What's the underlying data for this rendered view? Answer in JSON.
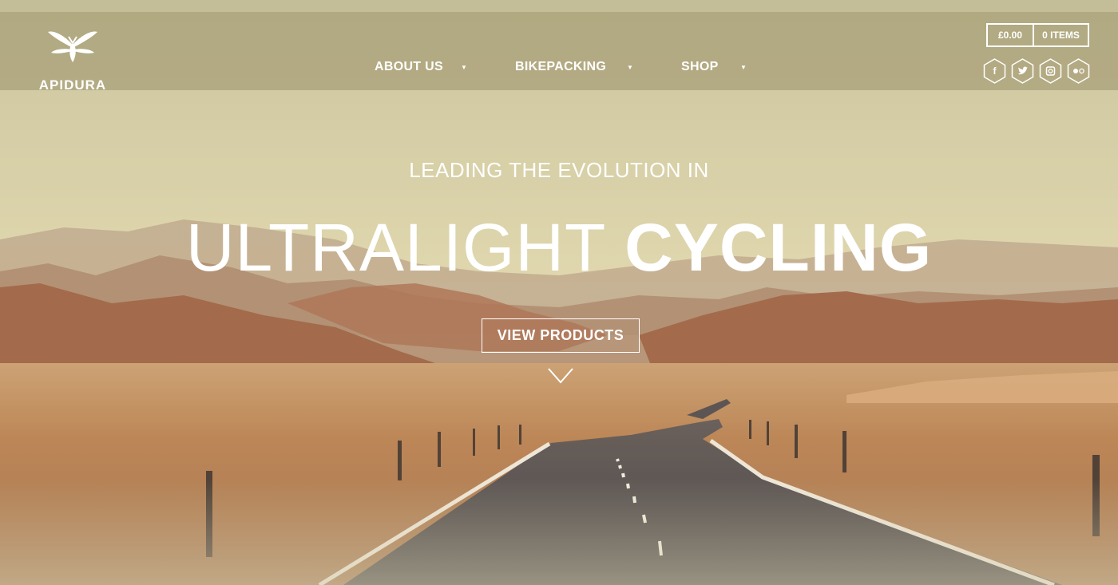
{
  "brand": {
    "name": "APIDURA"
  },
  "nav": {
    "items": [
      {
        "label": "ABOUT US"
      },
      {
        "label": "BIKEPACKING"
      },
      {
        "label": "SHOP"
      }
    ],
    "caret": "▼"
  },
  "cart": {
    "total": "£0.00",
    "items": "0 ITEMS"
  },
  "social": [
    {
      "name": "facebook-icon",
      "glyph": "f"
    },
    {
      "name": "twitter-icon",
      "glyph": "t"
    },
    {
      "name": "instagram-icon",
      "glyph": ""
    },
    {
      "name": "flickr-icon",
      "glyph": ""
    }
  ],
  "hero": {
    "kicker": "LEADING THE EVOLUTION IN",
    "headline_light": "ULTRALIGHT",
    "headline_bold": "CYCLING",
    "cta_label": "VIEW PRODUCTS"
  },
  "colors": {
    "sky": "#ddd6ad",
    "nav_overlay": "#a09870",
    "desert": "#b27748",
    "road": "#3f3b3f"
  }
}
